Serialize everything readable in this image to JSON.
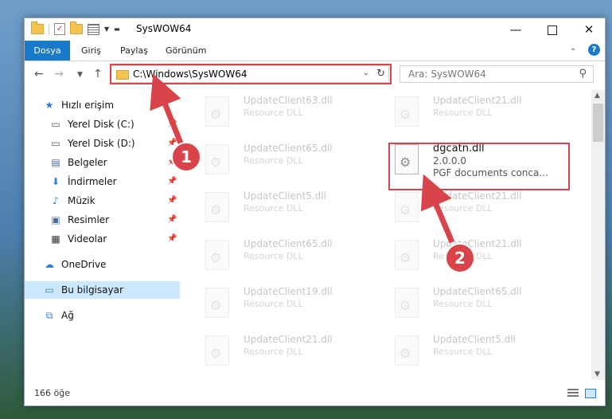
{
  "window": {
    "title": "SysWOW64"
  },
  "ribbon": {
    "tabs": [
      "Dosya",
      "Giriş",
      "Paylaş",
      "Görünüm"
    ]
  },
  "address": {
    "path": "C:\\Windows\\SysWOW64"
  },
  "search": {
    "placeholder": "Ara: SysWOW64"
  },
  "nav": {
    "items": [
      {
        "label": "Hızlı erişim",
        "icon": "star-icon"
      },
      {
        "label": "Yerel Disk (C:)",
        "icon": "drive-icon"
      },
      {
        "label": "Yerel Disk (D:)",
        "icon": "drive-icon"
      },
      {
        "label": "Belgeler",
        "icon": "documents-icon"
      },
      {
        "label": "İndirmeler",
        "icon": "download-icon"
      },
      {
        "label": "Müzik",
        "icon": "music-icon"
      },
      {
        "label": "Resimler",
        "icon": "pictures-icon"
      },
      {
        "label": "Videolar",
        "icon": "videos-icon"
      },
      {
        "label": "OneDrive",
        "icon": "cloud-icon"
      },
      {
        "label": "Bu bilgisayar",
        "icon": "computer-icon"
      },
      {
        "label": "Ağ",
        "icon": "network-icon"
      }
    ]
  },
  "files": [
    {
      "name": "UpdateClient63.dll",
      "line2": "Resource DLL",
      "line3": ""
    },
    {
      "name": "UpdateClient21.dll",
      "line2": "Resource DLL",
      "line3": ""
    },
    {
      "name": "UpdateClient65.dll",
      "line2": "Resource DLL",
      "line3": ""
    },
    {
      "name": "dgcatn.dll",
      "line2": "2.0.0.0",
      "line3": "PGF documents conca..."
    },
    {
      "name": "UpdateClient5.dll",
      "line2": "Resource DLL",
      "line3": ""
    },
    {
      "name": "UpdateClient21.dll",
      "line2": "Resource DLL",
      "line3": ""
    },
    {
      "name": "UpdateClient65.dll",
      "line2": "Resource DLL",
      "line3": ""
    },
    {
      "name": "UpdateClient21.dll",
      "line2": "Resource DLL",
      "line3": ""
    },
    {
      "name": "UpdateClient19.dll",
      "line2": "Resource DLL",
      "line3": ""
    },
    {
      "name": "UpdateClient65.dll",
      "line2": "Resource DLL",
      "line3": ""
    },
    {
      "name": "UpdateClient21.dll",
      "line2": "Resource DLL",
      "line3": ""
    },
    {
      "name": "UpdateClient5.dll",
      "line2": "Resource DLL",
      "line3": ""
    }
  ],
  "status": {
    "count": "166 öğe"
  },
  "annotations": {
    "step1": "1",
    "step2": "2",
    "color": "#d9444a"
  }
}
